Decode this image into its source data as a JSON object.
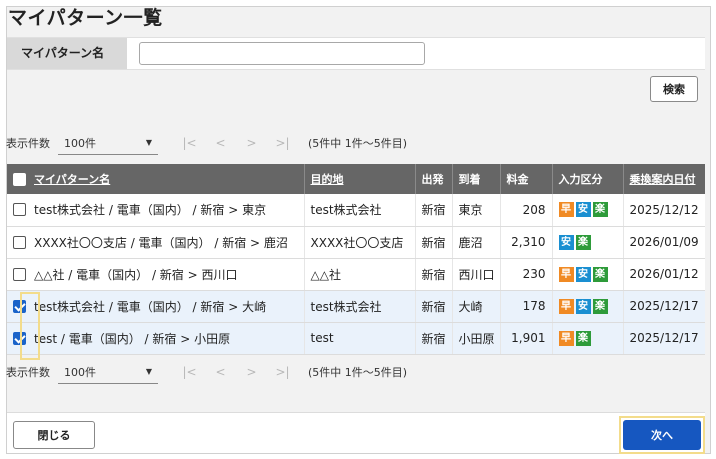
{
  "page": {
    "title": "マイパターン一覧"
  },
  "search": {
    "label": "マイパターン名",
    "value": "",
    "placeholder": "",
    "button": "検索"
  },
  "pager": {
    "size_label": "表示件数",
    "size_value": "100件",
    "range_text": "(5件中 1件～5件目)",
    "first_icon": "first-page-icon",
    "prev_icon": "prev-page-icon",
    "next_icon": "next-page-icon",
    "last_icon": "last-page-icon"
  },
  "table": {
    "headers": {
      "name": "マイパターン名",
      "destination": "目的地",
      "departure": "出発",
      "arrival": "到着",
      "fare": "料金",
      "input_type": "入力区分",
      "date": "乗換案内日付"
    },
    "rows": [
      {
        "checked": false,
        "name": "test株式会社 / 電車（国内） / 新宿 > 東京",
        "destination": "test株式会社",
        "departure": "新宿",
        "arrival": "東京",
        "fare": "208",
        "badges": [
          "早",
          "安",
          "楽"
        ],
        "date": "2025/12/12"
      },
      {
        "checked": false,
        "name": "XXXX社〇〇支店 / 電車（国内） / 新宿 > 鹿沼",
        "destination": "XXXX社〇〇支店",
        "departure": "新宿",
        "arrival": "鹿沼",
        "fare": "2,310",
        "badges": [
          "安",
          "楽"
        ],
        "date": "2026/01/09"
      },
      {
        "checked": false,
        "name": "△△社 / 電車（国内） / 新宿 > 西川口",
        "destination": "△△社",
        "departure": "新宿",
        "arrival": "西川口",
        "fare": "230",
        "badges": [
          "早",
          "安",
          "楽"
        ],
        "date": "2026/01/12"
      },
      {
        "checked": true,
        "name": "test株式会社 / 電車（国内） / 新宿 > 大崎",
        "destination": "test株式会社",
        "departure": "新宿",
        "arrival": "大崎",
        "fare": "178",
        "badges": [
          "早",
          "安",
          "楽"
        ],
        "date": "2025/12/17"
      },
      {
        "checked": true,
        "name": "test / 電車（国内） / 新宿 > 小田原",
        "destination": "test",
        "departure": "新宿",
        "arrival": "小田原",
        "fare": "1,901",
        "badges": [
          "早",
          "楽"
        ],
        "date": "2025/12/17"
      }
    ]
  },
  "footer": {
    "close": "閉じる",
    "next": "次へ"
  },
  "colors": {
    "accent": "#1657c0",
    "header_bg": "#666666",
    "haya": "#f08a24",
    "an": "#1a8fd1",
    "raku": "#2e9b3a",
    "highlight": "#f3dc8b"
  }
}
